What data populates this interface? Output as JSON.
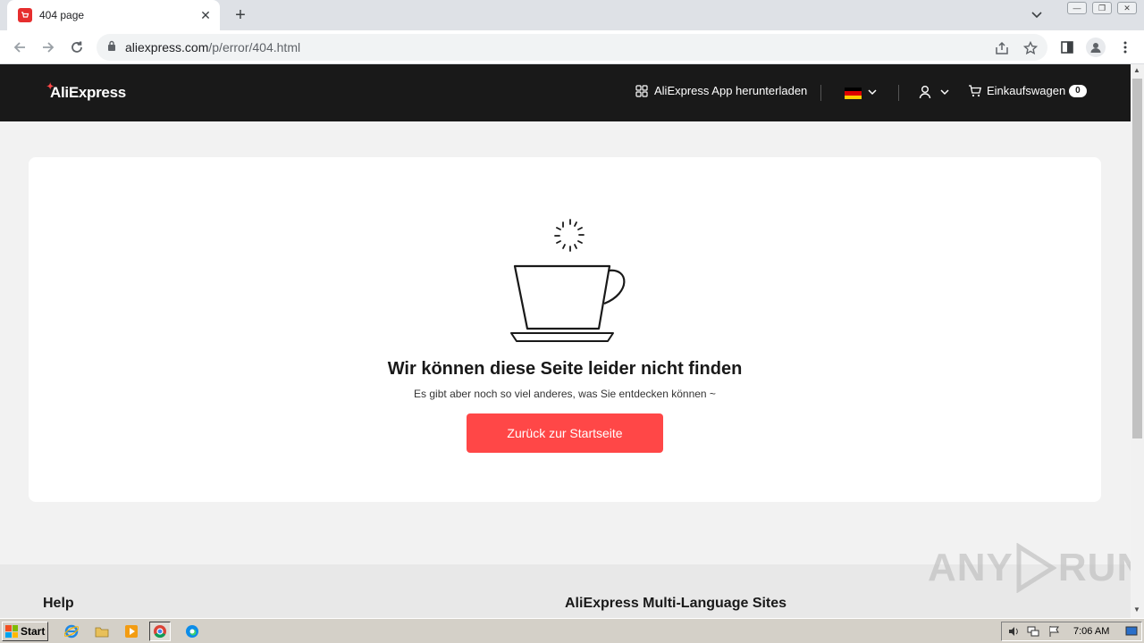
{
  "browser": {
    "tab_title": "404 page",
    "url_host": "aliexpress.com",
    "url_path": "/p/error/404.html"
  },
  "header": {
    "logo": "AliExpress",
    "app_download": "AliExpress App herunterladen",
    "cart_label": "Einkaufswagen",
    "cart_count": "0"
  },
  "error": {
    "title": "Wir können diese Seite leider nicht finden",
    "subtitle": "Es gibt aber noch so viel anderes, was Sie entdecken können ~",
    "button": "Zurück zur Startseite"
  },
  "footer": {
    "help_heading": "Help",
    "multilang_heading": "AliExpress Multi-Language Sites"
  },
  "watermark": {
    "text_left": "ANY",
    "text_right": "RUN"
  },
  "taskbar": {
    "start_label": "Start",
    "clock": "7:06 AM"
  },
  "colors": {
    "accent": "#ff4747",
    "header_bg": "#191919",
    "page_bg": "#f2f2f2"
  }
}
